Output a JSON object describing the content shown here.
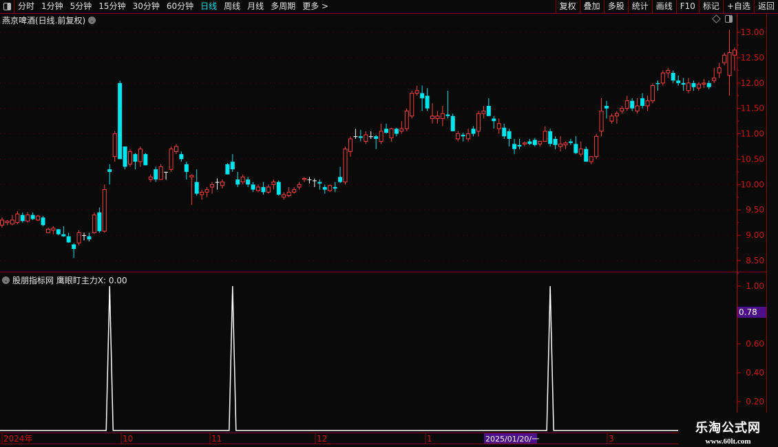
{
  "toolbar": {
    "periods": [
      "分时",
      "1分钟",
      "5分钟",
      "15分钟",
      "30分钟",
      "60分钟",
      "日线",
      "周线",
      "月线",
      "多周期",
      "更多 >"
    ],
    "active_period": "日线",
    "buttons": [
      "复权",
      "叠加",
      "多股",
      "统计",
      "画线",
      "F10",
      "标记",
      "+自选",
      "返回"
    ]
  },
  "main_title": "燕京啤酒(日线.前复权)",
  "indicator_title": "股朋指标网 鹰眼盯主力X: 0.00",
  "price_axis": {
    "ticks": [
      "13.00",
      "12.50",
      "12.00",
      "11.50",
      "11.00",
      "10.50",
      "10.00",
      "9.50",
      "9.00",
      "8.50"
    ]
  },
  "indicator_axis": {
    "ticks": [
      "1.00",
      "0.60",
      "0.40",
      "0.20"
    ],
    "current_value_badge": "0.78"
  },
  "date_axis": {
    "labels": [
      "2024年",
      "10",
      "11",
      "12",
      "1",
      "3"
    ],
    "cursor_date": "2025/01/20/一"
  },
  "watermark": {
    "name": "乐淘公式网",
    "url": "www.60lt.com"
  },
  "colors": {
    "up": "#ff3b3b",
    "down": "#00e5ee",
    "doji": "#ffffff",
    "axis": "#c00000",
    "badge": "#4b0f8a",
    "grid": "#5a0000"
  },
  "chart_data": [
    {
      "type": "candlestick",
      "title": "燕京啤酒(日线.前复权)",
      "ylim": [
        8.4,
        13.1
      ],
      "ohlc_fields": [
        "open",
        "high",
        "low",
        "close"
      ],
      "candles": [
        [
          9.2,
          9.35,
          9.15,
          9.3
        ],
        [
          9.25,
          9.3,
          9.2,
          9.28
        ],
        [
          9.22,
          9.4,
          9.2,
          9.3
        ],
        [
          9.25,
          9.48,
          9.22,
          9.42
        ],
        [
          9.4,
          9.45,
          9.25,
          9.28
        ],
        [
          9.28,
          9.46,
          9.25,
          9.4
        ],
        [
          9.4,
          9.45,
          9.3,
          9.32
        ],
        [
          9.3,
          9.4,
          9.28,
          9.38
        ],
        [
          9.35,
          9.38,
          9.18,
          9.2
        ],
        [
          9.05,
          9.15,
          9.05,
          9.12
        ],
        [
          9.1,
          9.18,
          9.02,
          9.14
        ],
        [
          9.12,
          9.12,
          9.0,
          9.02
        ],
        [
          9.02,
          9.18,
          8.97,
          8.98
        ],
        [
          8.98,
          9.05,
          8.85,
          8.86
        ],
        [
          8.82,
          8.84,
          8.55,
          8.73
        ],
        [
          8.85,
          9.1,
          8.8,
          9.05
        ],
        [
          9.0,
          9.05,
          8.9,
          9.0
        ],
        [
          8.98,
          9.05,
          8.88,
          8.92
        ],
        [
          9.05,
          9.45,
          9.03,
          9.4
        ],
        [
          9.45,
          9.55,
          9.05,
          9.08
        ],
        [
          9.08,
          10.0,
          9.05,
          9.9
        ],
        [
          10.3,
          10.4,
          10.0,
          10.25
        ],
        [
          10.55,
          11.05,
          10.45,
          11.0
        ],
        [
          12.0,
          12.05,
          10.5,
          10.5
        ],
        [
          10.75,
          10.75,
          10.3,
          10.35
        ],
        [
          10.4,
          10.7,
          10.35,
          10.65
        ],
        [
          10.6,
          10.62,
          10.3,
          10.45
        ],
        [
          10.45,
          10.75,
          10.35,
          10.7
        ],
        [
          10.6,
          10.62,
          10.38,
          10.38
        ],
        [
          10.1,
          10.2,
          10.05,
          10.15
        ],
        [
          10.3,
          10.35,
          10.05,
          10.1
        ],
        [
          10.1,
          10.4,
          10.1,
          10.35
        ],
        [
          10.25,
          10.25,
          10.1,
          10.25
        ],
        [
          10.3,
          10.75,
          10.25,
          10.7
        ],
        [
          10.65,
          10.8,
          10.6,
          10.75
        ],
        [
          10.6,
          10.65,
          10.45,
          10.5
        ],
        [
          10.4,
          10.45,
          10.1,
          10.25
        ],
        [
          10.15,
          10.2,
          9.6,
          10.18
        ],
        [
          10.05,
          10.3,
          9.78,
          9.82
        ],
        [
          9.8,
          9.9,
          9.7,
          9.85
        ],
        [
          9.85,
          9.95,
          9.75,
          9.9
        ],
        [
          9.95,
          10.05,
          9.82,
          10.0
        ],
        [
          10.05,
          10.12,
          9.9,
          10.05
        ],
        [
          9.98,
          10.1,
          9.92,
          10.05
        ],
        [
          10.4,
          10.42,
          10.2,
          10.2
        ],
        [
          10.45,
          10.6,
          10.25,
          10.3
        ],
        [
          10.1,
          10.25,
          9.95,
          10.0
        ],
        [
          10.05,
          10.2,
          10.0,
          10.15
        ],
        [
          10.1,
          10.15,
          9.95,
          10.0
        ],
        [
          10.0,
          10.05,
          9.85,
          9.9
        ],
        [
          9.88,
          10.0,
          9.85,
          9.95
        ],
        [
          9.95,
          10.05,
          9.8,
          9.85
        ],
        [
          9.85,
          10.0,
          9.82,
          9.95
        ],
        [
          10.0,
          10.1,
          9.9,
          10.05
        ],
        [
          10.05,
          10.08,
          9.78,
          9.8
        ],
        [
          9.75,
          9.85,
          9.7,
          9.8
        ],
        [
          9.78,
          9.95,
          9.75,
          9.85
        ],
        [
          9.85,
          9.95,
          9.82,
          9.9
        ],
        [
          9.95,
          10.05,
          9.9,
          10.0
        ],
        [
          10.1,
          10.15,
          10.05,
          10.12
        ],
        [
          10.1,
          10.15,
          10.02,
          10.1
        ],
        [
          10.08,
          10.12,
          9.95,
          10.08
        ],
        [
          10.05,
          10.1,
          9.9,
          10.02
        ],
        [
          9.95,
          10.0,
          9.82,
          9.9
        ],
        [
          9.88,
          10.0,
          9.85,
          9.98
        ],
        [
          9.95,
          10.05,
          9.85,
          9.92
        ],
        [
          10.15,
          10.35,
          10.03,
          10.05
        ],
        [
          10.05,
          10.75,
          10.0,
          10.7
        ],
        [
          10.65,
          10.95,
          10.55,
          10.9
        ],
        [
          10.95,
          11.1,
          10.9,
          10.95
        ],
        [
          10.95,
          11.08,
          10.85,
          10.92
        ],
        [
          10.85,
          11.05,
          10.8,
          10.98
        ],
        [
          10.95,
          11.05,
          10.9,
          10.95
        ],
        [
          10.95,
          10.98,
          10.7,
          10.9
        ],
        [
          10.85,
          11.2,
          10.8,
          11.05
        ],
        [
          11.1,
          11.2,
          11.0,
          11.02
        ],
        [
          10.92,
          11.12,
          10.85,
          11.1
        ],
        [
          11.1,
          11.12,
          10.95,
          11.0
        ],
        [
          11.05,
          11.25,
          11.0,
          11.1
        ],
        [
          11.1,
          11.5,
          11.05,
          11.45
        ],
        [
          11.35,
          11.85,
          11.3,
          11.8
        ],
        [
          11.8,
          11.95,
          11.75,
          11.85
        ],
        [
          11.8,
          11.95,
          11.45,
          11.7
        ],
        [
          11.75,
          11.9,
          11.45,
          11.5
        ],
        [
          11.3,
          11.6,
          11.2,
          11.35
        ],
        [
          11.3,
          11.45,
          11.2,
          11.35
        ],
        [
          11.3,
          11.55,
          11.15,
          11.4
        ],
        [
          11.38,
          11.85,
          11.3,
          11.35
        ],
        [
          11.35,
          11.4,
          11.05,
          11.05
        ],
        [
          10.9,
          11.05,
          10.85,
          11.0
        ],
        [
          10.98,
          11.02,
          10.85,
          10.95
        ],
        [
          10.9,
          11.1,
          10.85,
          11.0
        ],
        [
          11.1,
          11.15,
          10.95,
          11.0
        ],
        [
          11.05,
          11.45,
          10.95,
          11.4
        ],
        [
          11.4,
          11.55,
          11.3,
          11.45
        ],
        [
          11.55,
          11.7,
          11.35,
          11.35
        ],
        [
          11.3,
          11.35,
          11.1,
          11.25
        ],
        [
          11.1,
          11.3,
          11.0,
          11.2
        ],
        [
          11.12,
          11.2,
          10.9,
          10.95
        ],
        [
          11.05,
          11.1,
          10.75,
          10.9
        ],
        [
          10.8,
          10.9,
          10.6,
          10.7
        ],
        [
          10.78,
          10.9,
          10.7,
          10.75
        ],
        [
          10.8,
          10.85,
          10.75,
          10.82
        ],
        [
          10.85,
          10.9,
          10.78,
          10.8
        ],
        [
          10.88,
          10.92,
          10.75,
          10.78
        ],
        [
          10.8,
          10.82,
          10.75,
          10.85
        ],
        [
          10.85,
          11.15,
          10.85,
          11.05
        ],
        [
          11.05,
          11.1,
          10.75,
          10.8
        ],
        [
          10.9,
          10.95,
          10.7,
          10.78
        ],
        [
          10.75,
          10.95,
          10.65,
          10.8
        ],
        [
          10.78,
          10.85,
          10.7,
          10.82
        ],
        [
          10.85,
          10.9,
          10.78,
          10.82
        ],
        [
          10.8,
          10.95,
          10.6,
          10.62
        ],
        [
          10.6,
          10.85,
          10.55,
          10.7
        ],
        [
          10.7,
          10.75,
          10.45,
          10.45
        ],
        [
          10.45,
          10.55,
          10.4,
          10.55
        ],
        [
          10.55,
          11.0,
          10.5,
          10.95
        ],
        [
          11.05,
          11.7,
          10.95,
          11.45
        ],
        [
          11.55,
          11.65,
          11.3,
          11.5
        ],
        [
          11.25,
          11.4,
          11.2,
          11.35
        ],
        [
          11.35,
          11.45,
          11.2,
          11.4
        ],
        [
          11.45,
          11.55,
          11.4,
          11.5
        ],
        [
          11.5,
          11.75,
          11.45,
          11.65
        ],
        [
          11.65,
          11.7,
          11.45,
          11.5
        ],
        [
          11.45,
          11.7,
          11.4,
          11.55
        ],
        [
          11.7,
          11.8,
          11.5,
          11.55
        ],
        [
          11.55,
          11.75,
          11.45,
          11.65
        ],
        [
          11.65,
          12.0,
          11.6,
          11.95
        ],
        [
          12.0,
          12.05,
          11.85,
          11.98
        ],
        [
          12.0,
          12.25,
          11.95,
          12.2
        ],
        [
          12.2,
          12.3,
          12.1,
          12.25
        ],
        [
          12.2,
          12.25,
          12.0,
          12.05
        ],
        [
          12.05,
          12.15,
          11.95,
          12.0
        ],
        [
          12.0,
          12.1,
          11.85,
          11.97
        ],
        [
          11.85,
          12.1,
          11.8,
          12.0
        ],
        [
          12.0,
          12.05,
          11.85,
          11.92
        ],
        [
          11.9,
          12.02,
          11.85,
          11.98
        ],
        [
          11.98,
          12.08,
          11.9,
          12.0
        ],
        [
          12.0,
          12.05,
          11.88,
          11.92
        ],
        [
          12.05,
          12.3,
          12.0,
          12.1
        ],
        [
          12.2,
          12.4,
          12.1,
          12.3
        ],
        [
          12.4,
          12.6,
          12.35,
          12.55
        ],
        [
          12.15,
          13.05,
          11.75,
          12.6
        ],
        [
          12.55,
          12.7,
          12.25,
          12.65
        ]
      ]
    },
    {
      "type": "line",
      "title": "鹰眼盯主力X",
      "ylim": [
        0,
        1.05
      ],
      "signal_candle_indices": [
        21,
        45,
        107
      ],
      "signal_value": 1.0,
      "baseline_value": 0.0
    }
  ]
}
